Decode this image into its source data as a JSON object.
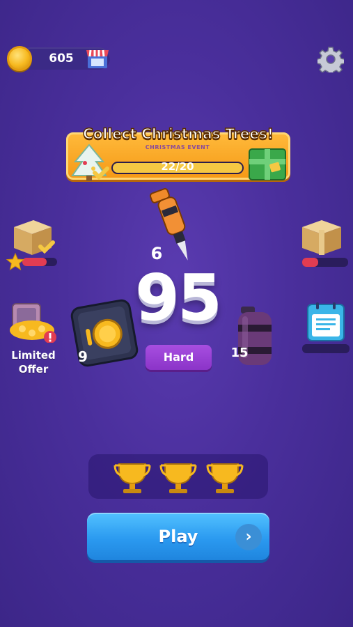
{
  "header": {
    "coins": "605",
    "coin_icon": "coin-icon",
    "shop_icon": "shop-icon",
    "settings_icon": "gear-icon"
  },
  "event": {
    "title": "Collect Christmas Trees!",
    "subtitle": "CHRISTMAS EVENT",
    "progress_text": "22/20",
    "progress_fraction": 1.0
  },
  "side": {
    "left_box_progress": 0.7,
    "right_box_progress": 0.35,
    "limited_offer": "Limited\nOffer"
  },
  "level": {
    "previous": "6",
    "current": "95",
    "difficulty": "Hard",
    "left_reward_level": "9",
    "right_reward_level": "15"
  },
  "trophies": {
    "count": 3
  },
  "play": {
    "label": "Play",
    "arrow": "›"
  },
  "colors": {
    "background": "#4a2f9c",
    "banner": "#f7a523",
    "play": "#2b9af0",
    "difficulty": "#9a40d6",
    "bar_fill": "#e23c52"
  }
}
